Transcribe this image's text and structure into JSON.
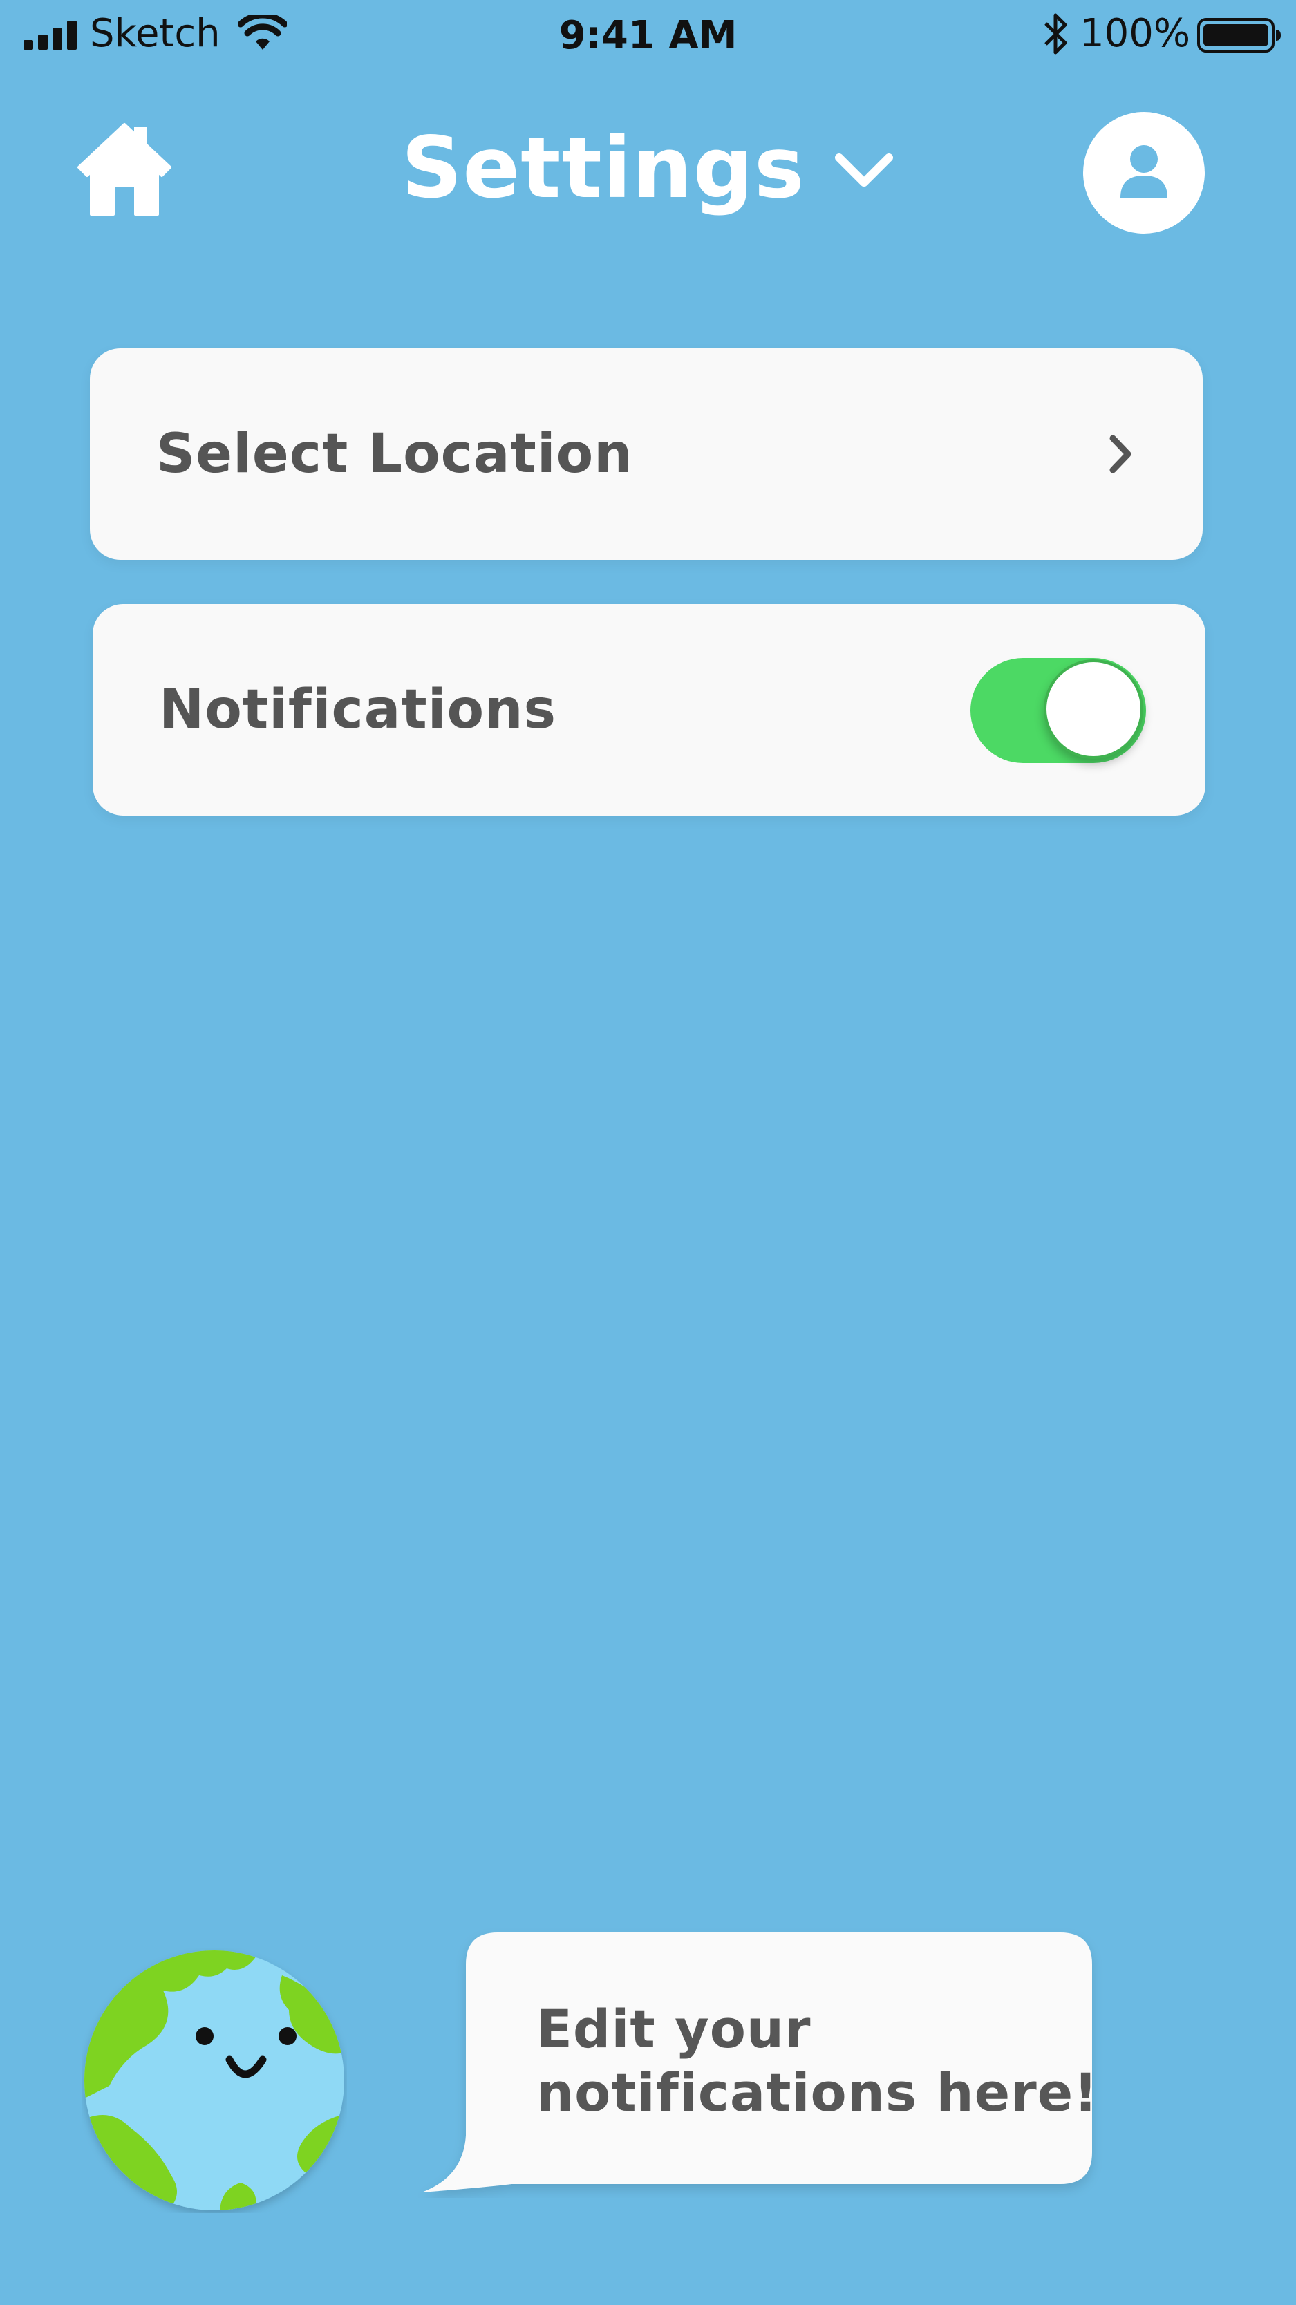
{
  "status_bar": {
    "carrier": "Sketch",
    "time": "9:41 AM",
    "battery_percent": "100%",
    "icons": [
      "signal-icon",
      "wifi-icon",
      "bluetooth-icon",
      "battery-icon"
    ]
  },
  "header": {
    "title": "Settings",
    "icons": {
      "home": "home-icon",
      "dropdown": "chevron-down-icon",
      "profile": "user-icon"
    }
  },
  "settings": {
    "location": {
      "label": "Select Location",
      "icon": "chevron-right-icon"
    },
    "notifications": {
      "label": "Notifications",
      "enabled": true
    }
  },
  "assistant": {
    "mascot": "smiling-earth-icon",
    "message_lines": [
      "Edit your",
      "notifications here!"
    ]
  },
  "colors": {
    "background": "#6bbae3",
    "card": "#f9f9f9",
    "text": "#555555",
    "toggle_on": "#4cd964",
    "earth_water": "#8fd9f5",
    "earth_land": "#7ed321",
    "status_text": "#111111"
  }
}
